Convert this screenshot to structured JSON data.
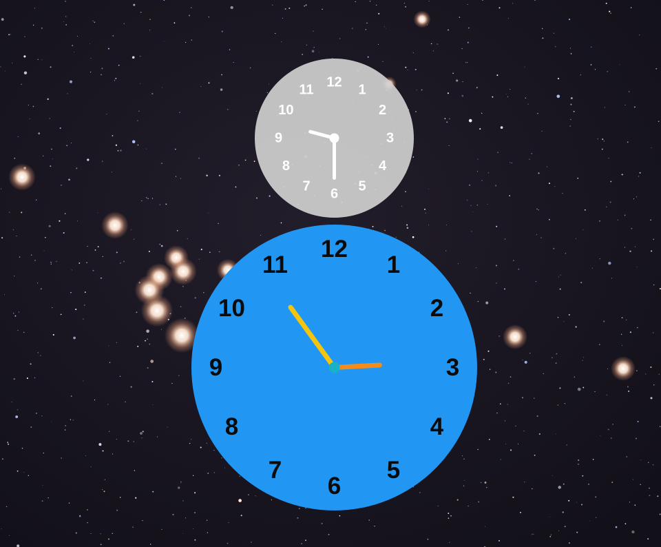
{
  "wallpaper": {
    "description_icon": "starfield-wallpaper",
    "background_color": "#161420",
    "star_color": "#ffffff",
    "bright_star_color": "#ffd9c0"
  },
  "small_clock": {
    "face_color": "#cfcfcf",
    "numeral_color": "#ffffff",
    "hand_color": "#ffffff",
    "numerals": [
      "12",
      "1",
      "2",
      "3",
      "4",
      "5",
      "6",
      "7",
      "8",
      "9",
      "10",
      "11"
    ],
    "time": {
      "hour": 9,
      "minute": 30
    }
  },
  "large_clock": {
    "face_color": "#2196f3",
    "numeral_color": "#0b0b0b",
    "hour_hand_color": "#f48c1c",
    "minute_hand_color": "#f5c40e",
    "center_color": "#1ab0c8",
    "numerals": [
      "12",
      "1",
      "2",
      "3",
      "4",
      "5",
      "6",
      "7",
      "8",
      "9",
      "10",
      "11"
    ],
    "time": {
      "hour": 2,
      "minute": 54
    }
  }
}
